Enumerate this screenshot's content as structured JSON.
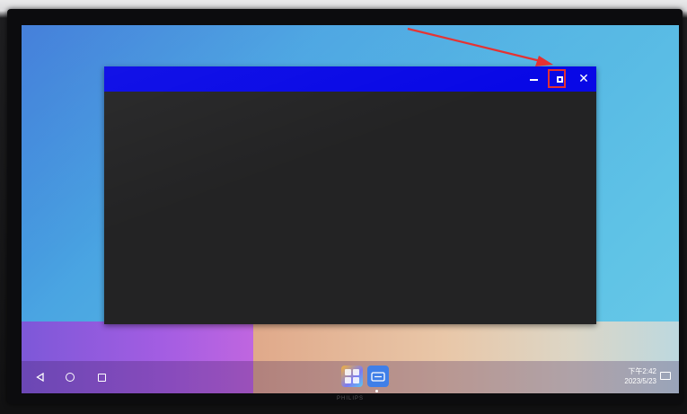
{
  "monitor": {
    "brand": "PHILIPS"
  },
  "window": {
    "title": "",
    "controls": {
      "minimize_icon": "minimize-icon",
      "maximize_icon": "maximize-icon",
      "close_glyph": "✕"
    },
    "titlebar_color": "#0808e6",
    "content_color": "#232324"
  },
  "annotation": {
    "highlight_color": "#e53030",
    "target": "maximize-button"
  },
  "navbar": {
    "back_icon": "back-triangle-icon",
    "home_icon": "home-circle-icon",
    "recent_icon": "recent-apps-square-icon"
  },
  "dock": {
    "apps": [
      {
        "icon": "app-launcher-icon"
      },
      {
        "icon": "meeting-app-icon"
      }
    ]
  },
  "status": {
    "time": "下午2:42",
    "date": "2023/5/23",
    "tray_icon": "screen-icon"
  }
}
